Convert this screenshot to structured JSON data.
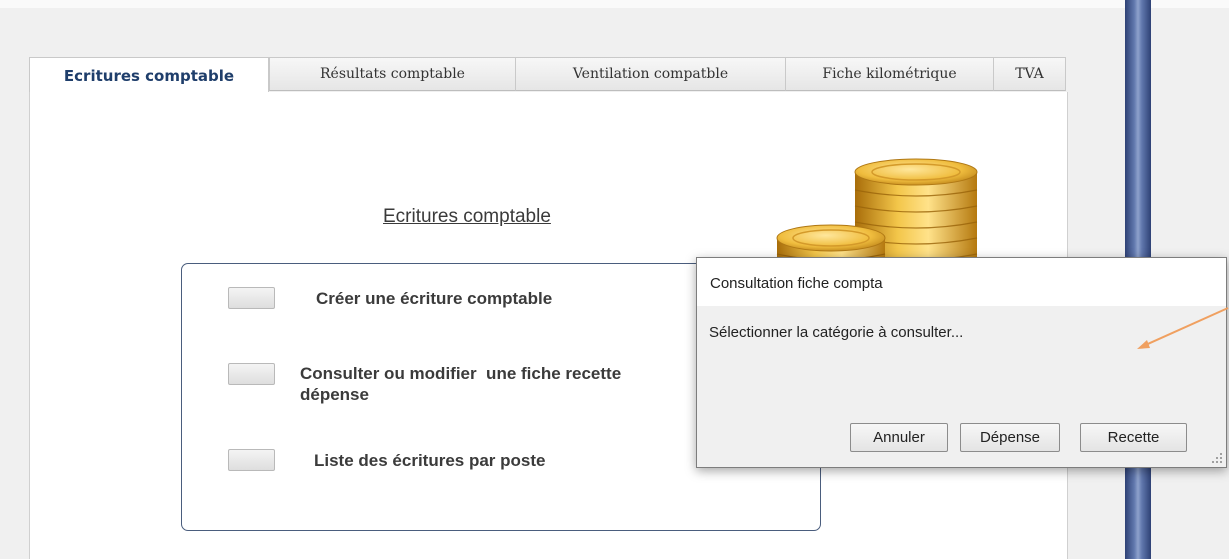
{
  "tabs": [
    {
      "label": "Ecritures comptable",
      "active": true
    },
    {
      "label": "Résultats comptable",
      "active": false
    },
    {
      "label": "Ventilation compatble",
      "active": false
    },
    {
      "label": "Fiche kilométrique",
      "active": false
    },
    {
      "label": "TVA",
      "active": false
    }
  ],
  "main": {
    "title": "Ecritures comptable",
    "options": [
      {
        "label": "Créer une écriture comptable"
      },
      {
        "label_line1": "Consulter ou modifier  une fiche recette",
        "label_line2": "dépense"
      },
      {
        "label": "Liste des écritures par poste"
      }
    ]
  },
  "dialog": {
    "title": "Consultation fiche compta",
    "message": "Sélectionner la catégorie à consulter...",
    "buttons": {
      "cancel": "Annuler",
      "expense": "Dépense",
      "income": "Recette"
    }
  },
  "colors": {
    "active_tab_text": "#1f3e6b",
    "annotation_arrow": "#f0a060",
    "side_bar": "#4a5f95"
  },
  "icons": {
    "illustration": "gold-coins-stack",
    "dialog_grip": "resize-grip-icon",
    "annotation": "arrow-annotation"
  }
}
